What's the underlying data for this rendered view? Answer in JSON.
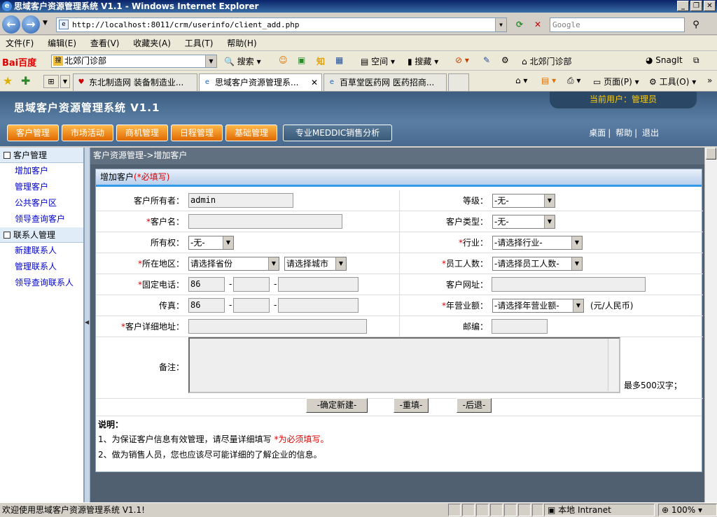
{
  "window": {
    "title": "思域客户资源管理系统 V1.1 - Windows Internet Explorer"
  },
  "browser": {
    "url": "http://localhost:8011/crm/userinfo/client_add.php",
    "search_placeholder": "Google",
    "menu": [
      "文件(F)",
      "编辑(E)",
      "查看(V)",
      "收藏夹(A)",
      "工具(T)",
      "帮助(H)"
    ],
    "baidu_logo": "Bai百度",
    "baidu_box": "北郊门诊部",
    "baidu_search": "搜索",
    "space": "空间",
    "collect": "搜藏",
    "clinic": "北郊门诊部",
    "snagit": "SnagIt",
    "tabs": [
      "东北制造网 装备制造业...",
      "思域客户资源管理系...",
      "百草堂医药网 医药招商..."
    ],
    "page_menu": "页面(P)",
    "tools_menu": "工具(O)"
  },
  "app": {
    "title": "思域客户资源管理系统 V1.1",
    "current_user": "当前用户：管理员",
    "nav": [
      "客户管理",
      "市场活动",
      "商机管理",
      "日程管理",
      "基础管理",
      "专业MEDDIC销售分析"
    ],
    "links": [
      "桌面",
      "帮助",
      "退出"
    ],
    "sidebar": [
      {
        "group": "客户管理",
        "items": [
          "增加客户",
          "管理客户",
          "公共客户区",
          "领导查询客户"
        ]
      },
      {
        "group": "联系人管理",
        "items": [
          "新建联系人",
          "管理联系人",
          "领导查询联系人"
        ]
      }
    ],
    "breadcrumb": "客户资源管理->增加客户"
  },
  "form": {
    "title": "增加客户",
    "required_hint": "(*必填写)",
    "owner_label": "客户所有者：",
    "owner_value": "admin",
    "level_label": "等级：",
    "level_value": "-无-",
    "name_label": "客户名：",
    "type_label": "客户类型：",
    "type_value": "-无-",
    "ownership_label": "所有权：",
    "ownership_value": "-无-",
    "industry_label": "行业：",
    "industry_value": "-请选择行业-",
    "region_label": "所在地区：",
    "province_value": "请选择省份",
    "city_value": "请选择城市",
    "staff_label": "员工人数：",
    "staff_value": "-请选择员工人数-",
    "phone_label": "固定电话：",
    "phone_code": "86",
    "website_label": "客户网址：",
    "fax_label": "传真：",
    "fax_code": "86",
    "revenue_label": "年营业额：",
    "revenue_value": "-请选择年营业额-",
    "revenue_unit": "(元/人民币)",
    "address_label": "客户详细地址：",
    "zip_label": "邮编：",
    "remark_label": "备注：",
    "remark_limit": "最多500汉字；",
    "btn_submit": "-确定新建-",
    "btn_reset": "-重填-",
    "btn_back": "-后退-",
    "notes_title": "说明：",
    "note1_a": "1、为保证客户信息有效管理，请尽量详细填写 ",
    "note1_b": "*为必须填写。",
    "note2": "2、做为销售人员，您也应该尽可能详细的了解企业的信息。"
  },
  "status": {
    "text": "欢迎使用思域客户资源管理系统 V1.1!",
    "zone": "本地 Intranet",
    "zoom": "100%"
  }
}
